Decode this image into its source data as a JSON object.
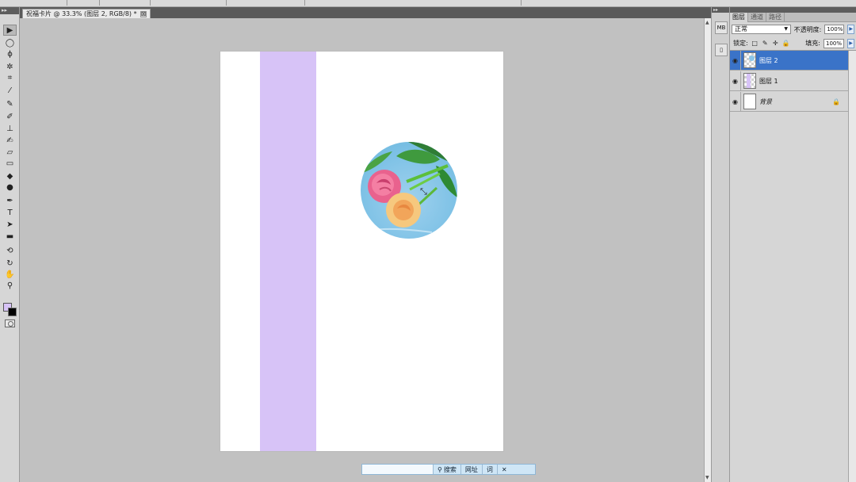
{
  "document": {
    "tab_title": "祝福卡片 @ 33.3% (图层 2, RGB/8) *",
    "close_symbol": "⊠"
  },
  "toolbox": {
    "tools": [
      {
        "name": "move-icon",
        "glyph": "▶"
      },
      {
        "name": "marquee-icon",
        "glyph": "◯"
      },
      {
        "name": "lasso-icon",
        "glyph": "ϕ"
      },
      {
        "name": "magic-wand-icon",
        "glyph": "✲"
      },
      {
        "name": "crop-icon",
        "glyph": "⌗"
      },
      {
        "name": "eyedropper-icon",
        "glyph": "⁄"
      },
      {
        "name": "healing-brush-icon",
        "glyph": "✎"
      },
      {
        "name": "brush-icon",
        "glyph": "✐"
      },
      {
        "name": "clone-stamp-icon",
        "glyph": "⊥"
      },
      {
        "name": "history-brush-icon",
        "glyph": "✍"
      },
      {
        "name": "eraser-icon",
        "glyph": "▱"
      },
      {
        "name": "gradient-icon",
        "glyph": "▭"
      },
      {
        "name": "blur-icon",
        "glyph": "◆"
      },
      {
        "name": "dodge-icon",
        "glyph": "●"
      },
      {
        "name": "pen-icon",
        "glyph": "✒"
      },
      {
        "name": "type-icon",
        "glyph": "T"
      },
      {
        "name": "path-selection-icon",
        "glyph": "➤"
      },
      {
        "name": "shape-icon",
        "glyph": "▬"
      },
      {
        "name": "3d-rotate-icon",
        "glyph": "⟲"
      },
      {
        "name": "3d-orbit-icon",
        "glyph": "↻"
      },
      {
        "name": "hand-icon",
        "glyph": "✋"
      },
      {
        "name": "zoom-icon",
        "glyph": "⚲"
      }
    ]
  },
  "imebar": {
    "search_label": "搜索",
    "address_label": "网址",
    "word_label": "词",
    "close_symbol": "✕"
  },
  "dock": {
    "btn1": "MB",
    "btn2": "▯"
  },
  "layers_panel": {
    "tabs": [
      "图层",
      "通道",
      "路径"
    ],
    "blend_mode": "正常",
    "opacity_label": "不透明度:",
    "opacity_value": "100%",
    "lock_label": "锁定:",
    "fill_label": "填充:",
    "fill_value": "100%",
    "layers": [
      {
        "name": "图层 2",
        "selected": true,
        "visible": true
      },
      {
        "name": "图层 1",
        "selected": false,
        "visible": true
      },
      {
        "name": "背景",
        "selected": false,
        "visible": true,
        "locked": true
      }
    ]
  },
  "colors": {
    "lavender": "#d7c3f7",
    "selection_blue": "#3a73c8"
  }
}
